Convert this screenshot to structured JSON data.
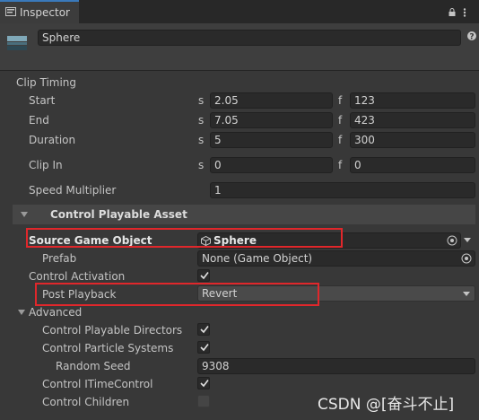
{
  "tab": {
    "title": "Inspector"
  },
  "object": {
    "name": "Sphere"
  },
  "clip_timing": {
    "heading": "Clip Timing",
    "rows": [
      {
        "label": "Start",
        "s_letter": "s",
        "s_value": "2.05",
        "f_letter": "f",
        "f_value": "123"
      },
      {
        "label": "End",
        "s_letter": "s",
        "s_value": "7.05",
        "f_letter": "f",
        "f_value": "423"
      },
      {
        "label": "Duration",
        "s_letter": "s",
        "s_value": "5",
        "f_letter": "f",
        "f_value": "300"
      },
      {
        "label": "Clip In",
        "s_letter": "s",
        "s_value": "0",
        "f_letter": "f",
        "f_value": "0"
      }
    ],
    "speed_label": "Speed Multiplier",
    "speed_value": "1"
  },
  "control_asset": {
    "title": "Control Playable Asset",
    "source_label": "Source Game Object",
    "source_value": "Sphere",
    "prefab_label": "Prefab",
    "prefab_value": "None (Game Object)",
    "activation_label": "Control Activation",
    "activation_checked": true,
    "post_playback_label": "Post Playback",
    "post_playback_value": "Revert",
    "advanced_label": "Advanced",
    "directors_label": "Control Playable Directors",
    "directors_checked": true,
    "particles_label": "Control Particle Systems",
    "particles_checked": true,
    "seed_label": "Random Seed",
    "seed_value": "9308",
    "itime_label": "Control ITimeControl",
    "itime_checked": true,
    "children_label": "Control Children",
    "children_checked": false
  },
  "watermark": "CSDN @[奋斗不止]",
  "colors": {
    "highlight": "#e0272b",
    "tab_accent": "#3a79bb",
    "background": "#383838"
  }
}
